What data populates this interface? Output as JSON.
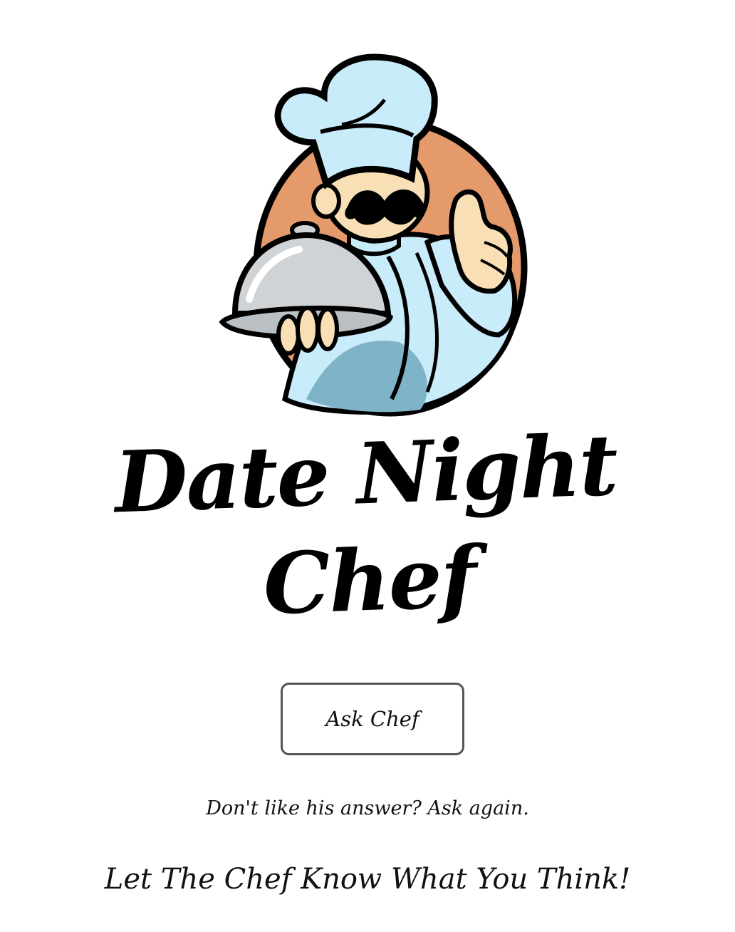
{
  "brand": {
    "name": "Date Night Chef",
    "logo_icon": "chef-mascot-icon"
  },
  "main": {
    "ask_button_label": "Ask Chef",
    "hint": "Don't like his answer? Ask again.",
    "feedback_link": "Let The Chef Know What You Think!"
  },
  "colors": {
    "background": "#ffffff",
    "logo_circle": "#e59a6b",
    "chef_uniform": "#c9ecfa",
    "cloche": "#cfd3d6",
    "skin": "#f9dfb5",
    "outline": "#000000"
  }
}
